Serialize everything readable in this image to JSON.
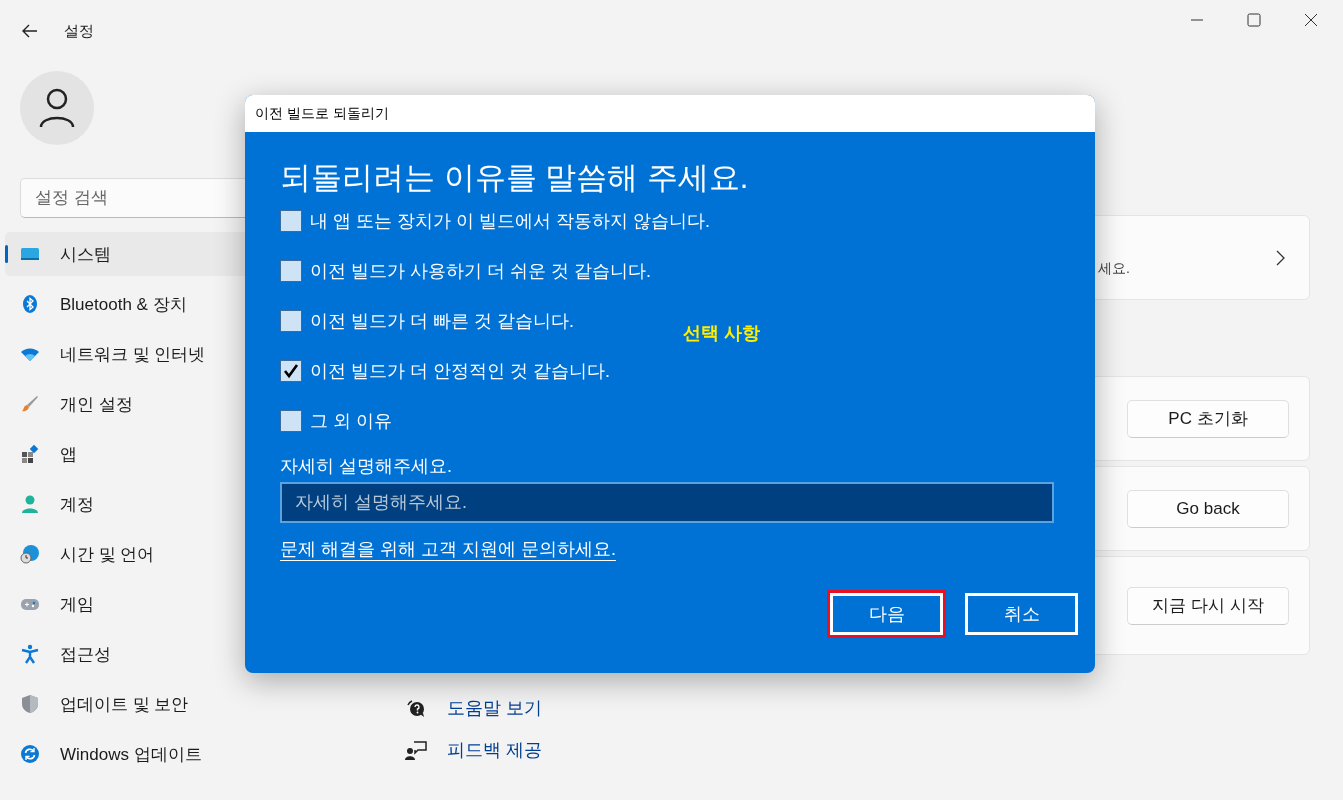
{
  "window": {
    "title": "설정"
  },
  "search": {
    "placeholder": "설정 검색"
  },
  "nav": [
    {
      "label": "시스템",
      "selected": true
    },
    {
      "label": "Bluetooth & 장치",
      "selected": false
    },
    {
      "label": "네트워크 및 인터넷",
      "selected": false
    },
    {
      "label": "개인 설정",
      "selected": false
    },
    {
      "label": "앱",
      "selected": false
    },
    {
      "label": "계정",
      "selected": false
    },
    {
      "label": "시간 및 언어",
      "selected": false
    },
    {
      "label": "게임",
      "selected": false
    },
    {
      "label": "접근성",
      "selected": false
    },
    {
      "label": "업데이트 및 보안",
      "selected": false
    },
    {
      "label": "Windows 업데이트",
      "selected": false
    }
  ],
  "cards": [
    {
      "kind": "link",
      "text": "세요."
    },
    {
      "kind": "button",
      "button": "PC 초기화"
    },
    {
      "kind": "button",
      "button": "Go back"
    },
    {
      "kind": "button",
      "button": "지금 다시 시작"
    }
  ],
  "help_links": [
    "도움말 보기",
    "피드백 제공"
  ],
  "dialog": {
    "title": "이전 빌드로 되돌리기",
    "heading": "되돌리려는 이유를 말씀해 주세요.",
    "reasons": [
      {
        "label": "내 앱 또는 장치가 이 빌드에서 작동하지 않습니다.",
        "checked": false
      },
      {
        "label": "이전 빌드가 사용하기 더 쉬운 것 같습니다.",
        "checked": false
      },
      {
        "label": "이전 빌드가 더 빠른 것 같습니다.",
        "checked": false
      },
      {
        "label": "이전 빌드가 더 안정적인 것 같습니다.",
        "checked": true
      },
      {
        "label": "그 외 이유",
        "checked": false
      }
    ],
    "annotation": "선택 사항",
    "details_label": "자세히 설명해주세요.",
    "details": {
      "placeholder": "자세히 설명해주세요."
    },
    "support_link": "문제 해결을 위해 고객 지원에 문의하세요.",
    "buttons": [
      {
        "label": "다음",
        "highlighted": true
      },
      {
        "label": "취소",
        "highlighted": false
      }
    ]
  }
}
